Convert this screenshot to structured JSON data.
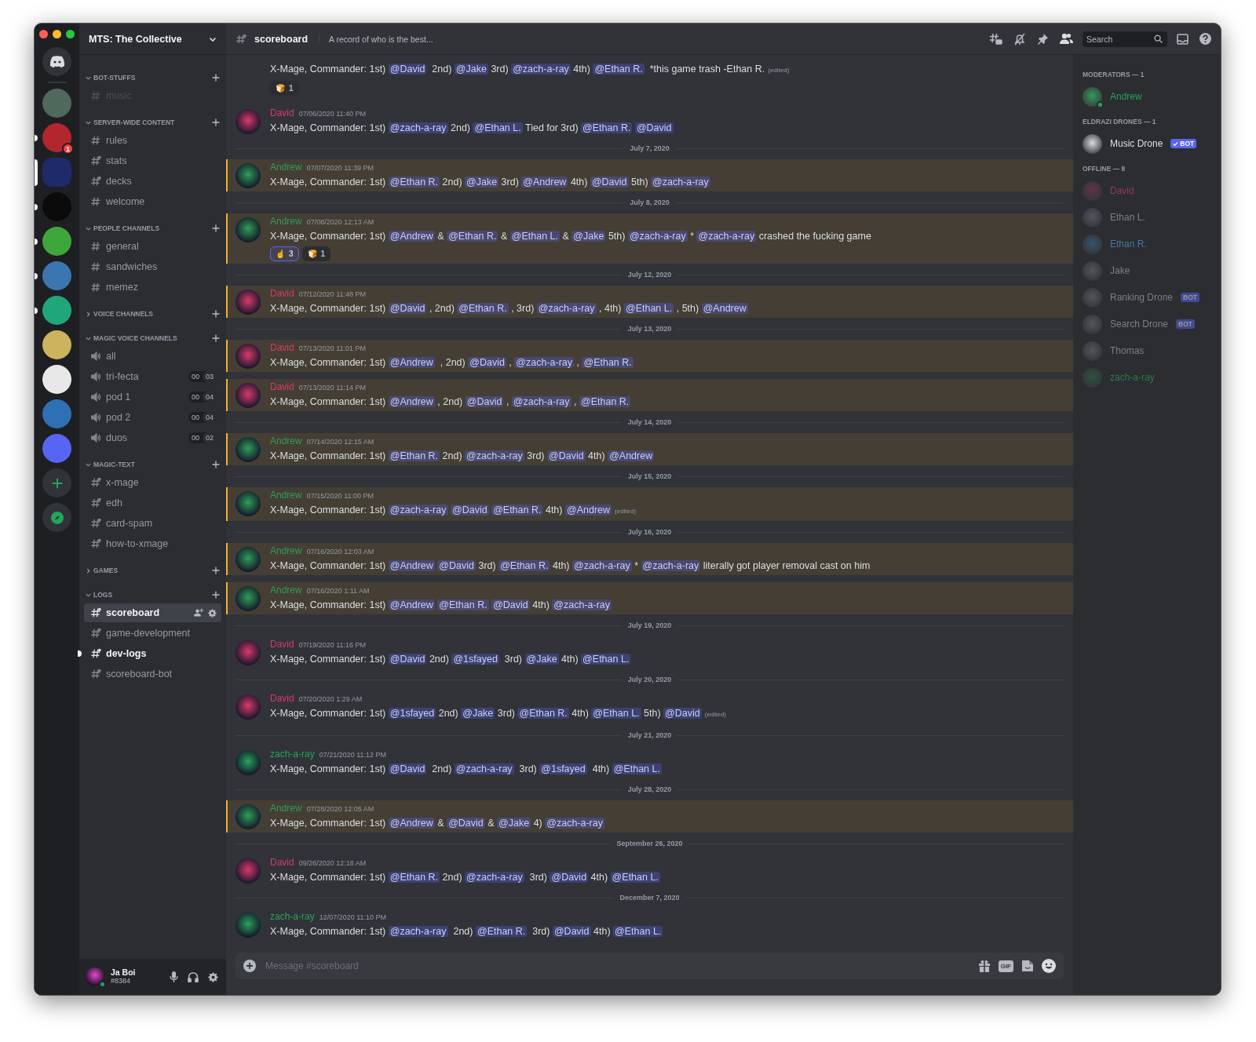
{
  "servers": [
    {
      "kind": "home",
      "selected": false,
      "unread": false
    },
    {
      "kind": "server",
      "color": "#4f6a5c",
      "selected": false,
      "unread": false
    },
    {
      "kind": "server",
      "color": "#b3262e",
      "selected": false,
      "unread": true,
      "badge": "1"
    },
    {
      "kind": "server",
      "color": "#1f2a6b",
      "selected": true,
      "unread": false
    },
    {
      "kind": "server",
      "color": "#0b0b0b",
      "selected": false,
      "unread": true
    },
    {
      "kind": "server",
      "color": "#3fa63b",
      "selected": false,
      "unread": true
    },
    {
      "kind": "server",
      "color": "#3b76b0",
      "selected": false,
      "unread": true
    },
    {
      "kind": "server",
      "color": "#1fa67a",
      "selected": false,
      "unread": true
    },
    {
      "kind": "server",
      "color": "#cdb35c",
      "selected": false,
      "unread": false
    },
    {
      "kind": "server",
      "color": "#e8e8e8",
      "selected": false,
      "unread": false
    },
    {
      "kind": "server",
      "color": "#2f6fb3",
      "selected": false,
      "unread": false
    },
    {
      "kind": "server",
      "color": "#5865f2",
      "selected": false,
      "unread": false
    },
    {
      "kind": "add",
      "selected": false,
      "unread": false
    },
    {
      "kind": "explore",
      "selected": false,
      "unread": false
    }
  ],
  "server": {
    "name": "MTS: The Collective",
    "categories": [
      {
        "name": "BOT-STUFFS",
        "expanded": true,
        "channels": [
          {
            "name": "music",
            "kind": "text",
            "selected": false,
            "unread": false,
            "muted": true
          }
        ]
      },
      {
        "name": "SERVER-WIDE CONTENT",
        "expanded": true,
        "channels": [
          {
            "name": "rules",
            "kind": "text",
            "selected": false,
            "unread": false,
            "muted": false
          },
          {
            "name": "stats",
            "kind": "locked",
            "selected": false,
            "unread": false,
            "muted": false
          },
          {
            "name": "decks",
            "kind": "locked",
            "selected": false,
            "unread": false,
            "muted": false
          },
          {
            "name": "welcome",
            "kind": "text",
            "selected": false,
            "unread": false,
            "muted": false
          }
        ]
      },
      {
        "name": "PEOPLE CHANNELS",
        "expanded": true,
        "channels": [
          {
            "name": "general",
            "kind": "text",
            "selected": false,
            "unread": false,
            "muted": false
          },
          {
            "name": "sandwiches",
            "kind": "text",
            "selected": false,
            "unread": false,
            "muted": false
          },
          {
            "name": "memez",
            "kind": "text",
            "selected": false,
            "unread": false,
            "muted": false
          }
        ]
      },
      {
        "name": "VOICE CHANNELS",
        "expanded": false
      },
      {
        "name": "MAGIC VOICE CHANNELS",
        "expanded": true,
        "channels": [
          {
            "name": "all",
            "kind": "voice",
            "selected": false,
            "unread": false,
            "muted": false
          },
          {
            "name": "tri-fecta",
            "kind": "voice",
            "selected": false,
            "unread": false,
            "muted": false,
            "users": "00",
            "limit": "03"
          },
          {
            "name": "pod 1",
            "kind": "voice",
            "selected": false,
            "unread": false,
            "muted": false,
            "users": "00",
            "limit": "04"
          },
          {
            "name": "pod 2",
            "kind": "voice",
            "selected": false,
            "unread": false,
            "muted": false,
            "users": "00",
            "limit": "04"
          },
          {
            "name": "duos",
            "kind": "voice",
            "selected": false,
            "unread": false,
            "muted": false,
            "users": "00",
            "limit": "02"
          }
        ]
      },
      {
        "name": "MAGIC-TEXT",
        "expanded": true,
        "channels": [
          {
            "name": "x-mage",
            "kind": "locked",
            "selected": false,
            "unread": false,
            "muted": false
          },
          {
            "name": "edh",
            "kind": "locked",
            "selected": false,
            "unread": false,
            "muted": false
          },
          {
            "name": "card-spam",
            "kind": "locked",
            "selected": false,
            "unread": false,
            "muted": false
          },
          {
            "name": "how-to-xmage",
            "kind": "locked",
            "selected": false,
            "unread": false,
            "muted": false
          }
        ]
      },
      {
        "name": "GAMES",
        "expanded": false
      },
      {
        "name": "LOGS",
        "expanded": true,
        "channels": [
          {
            "name": "scoreboard",
            "kind": "locked",
            "selected": true,
            "unread": false,
            "muted": false
          },
          {
            "name": "game-development",
            "kind": "locked",
            "selected": false,
            "unread": false,
            "muted": false
          },
          {
            "name": "dev-logs",
            "kind": "locked",
            "selected": false,
            "unread": true,
            "muted": false
          },
          {
            "name": "scoreboard-bot",
            "kind": "locked",
            "selected": false,
            "unread": false,
            "muted": false
          }
        ]
      }
    ]
  },
  "user": {
    "name": "Ja Boi",
    "tag": "#8384"
  },
  "channel_header": {
    "name": "scoreboard",
    "topic": "A record of who is the best...",
    "search_placeholder": "Search"
  },
  "feed": [
    {
      "kind": "message",
      "highlighted": false,
      "content": [
        "X-Mage, Commander: 1st) ",
        {
          "mention": "@David"
        },
        "  2nd) ",
        {
          "mention": "@Jake"
        },
        " 3rd) ",
        {
          "mention": "@zach-a-ray"
        },
        " 4th) ",
        {
          "mention": "@Ethan R."
        },
        "  *this game trash -Ethan R."
      ],
      "edited_note": "(edited)",
      "reactions": [
        {
          "emoji": "🍞",
          "count": "1",
          "selected": false
        }
      ]
    },
    {
      "kind": "message",
      "author": "David",
      "color": "#d83a6a",
      "timestamp": "07/06/2020 11:40 PM",
      "highlighted": false,
      "content": [
        "X-Mage, Commander: 1st) ",
        {
          "mention": "@zach-a-ray"
        },
        " 2nd) ",
        {
          "mention": "@Ethan L."
        },
        " Tied for 3rd) ",
        {
          "mention": "@Ethan R."
        },
        {
          "mention": "@David"
        }
      ]
    },
    {
      "kind": "divider",
      "label": "July 7, 2020"
    },
    {
      "kind": "message",
      "author": "Andrew",
      "color": "#2f9e58",
      "timestamp": "07/07/2020 11:39 PM",
      "highlighted": true,
      "content": [
        "X-Mage, Commander: 1st) ",
        {
          "mention": "@Ethan R."
        },
        " 2nd) ",
        {
          "mention": "@Jake"
        },
        " 3rd) ",
        {
          "mention": "@Andrew"
        },
        " 4th) ",
        {
          "mention": "@David"
        },
        " 5th) ",
        {
          "mention": "@zach-a-ray"
        }
      ]
    },
    {
      "kind": "divider",
      "label": "July 8, 2020"
    },
    {
      "kind": "message",
      "author": "Andrew",
      "color": "#2f9e58",
      "timestamp": "07/08/2020 12:13 AM",
      "highlighted": true,
      "content": [
        "X-Mage, Commander: 1st) ",
        {
          "mention": "@Andrew"
        },
        " & ",
        {
          "mention": "@Ethan R."
        },
        " & ",
        {
          "mention": "@Ethan L."
        },
        " & ",
        {
          "mention": "@Jake"
        },
        " 5th) ",
        {
          "mention": "@zach-a-ray"
        },
        " * ",
        {
          "mention": "@zach-a-ray"
        },
        " crashed the fucking game"
      ],
      "reactions": [
        {
          "emoji": "☝",
          "count": "3",
          "selected": true
        },
        {
          "emoji": "🍞",
          "count": "1",
          "selected": false
        }
      ]
    },
    {
      "kind": "divider",
      "label": "July 12, 2020"
    },
    {
      "kind": "message",
      "author": "David",
      "color": "#d83a6a",
      "timestamp": "07/12/2020 11:48 PM",
      "highlighted": true,
      "content": [
        "X-Mage, Commander: 1st) ",
        {
          "mention": "@David"
        },
        " , 2nd) ",
        {
          "mention": "@Ethan R."
        },
        " , 3rd) ",
        {
          "mention": "@zach-a-ray"
        },
        " , 4th) ",
        {
          "mention": "@Ethan L."
        },
        " , 5th) ",
        {
          "mention": "@Andrew"
        }
      ]
    },
    {
      "kind": "divider",
      "label": "July 13, 2020"
    },
    {
      "kind": "message",
      "author": "David",
      "color": "#d83a6a",
      "timestamp": "07/13/2020 11:01 PM",
      "highlighted": true,
      "content": [
        "X-Mage, Commander: 1st) ",
        {
          "mention": "@Andrew"
        },
        "  , 2nd) ",
        {
          "mention": "@David"
        },
        " , ",
        {
          "mention": "@zach-a-ray"
        },
        " , ",
        {
          "mention": "@Ethan R."
        }
      ]
    },
    {
      "kind": "message",
      "author": "David",
      "color": "#d83a6a",
      "timestamp": "07/13/2020 11:14 PM",
      "highlighted": true,
      "content": [
        "X-Mage, Commander: 1st) ",
        {
          "mention": "@Andrew"
        },
        " , 2nd) ",
        {
          "mention": "@David"
        },
        " , ",
        {
          "mention": "@zach-a-ray"
        },
        " , ",
        {
          "mention": "@Ethan R."
        }
      ]
    },
    {
      "kind": "divider",
      "label": "July 14, 2020"
    },
    {
      "kind": "message",
      "author": "Andrew",
      "color": "#2f9e58",
      "timestamp": "07/14/2020 12:15 AM",
      "highlighted": true,
      "content": [
        "X-Mage, Commander: 1st) ",
        {
          "mention": "@Ethan R."
        },
        " 2nd) ",
        {
          "mention": "@zach-a-ray"
        },
        " 3rd) ",
        {
          "mention": "@David"
        },
        " 4th) ",
        {
          "mention": "@Andrew"
        }
      ]
    },
    {
      "kind": "divider",
      "label": "July 15, 2020"
    },
    {
      "kind": "message",
      "author": "Andrew",
      "color": "#2f9e58",
      "timestamp": "07/15/2020 11:00 PM",
      "highlighted": true,
      "content": [
        "X-Mage, Commander: 1st) ",
        {
          "mention": "@zach-a-ray"
        },
        {
          "mention": "@David"
        },
        {
          "mention": "@Ethan R."
        },
        " 4th) ",
        {
          "mention": "@Andrew"
        }
      ],
      "edited_note": "(edited)"
    },
    {
      "kind": "divider",
      "label": "July 16, 2020"
    },
    {
      "kind": "message",
      "author": "Andrew",
      "color": "#2f9e58",
      "timestamp": "07/16/2020 12:03 AM",
      "highlighted": true,
      "content": [
        "X-Mage, Commander: 1st) ",
        {
          "mention": "@Andrew"
        },
        {
          "mention": "@David"
        },
        " 3rd) ",
        {
          "mention": "@Ethan R."
        },
        " 4th) ",
        {
          "mention": "@zach-a-ray"
        },
        " * ",
        {
          "mention": "@zach-a-ray"
        },
        " literally got player removal cast on him"
      ]
    },
    {
      "kind": "message",
      "author": "Andrew",
      "color": "#2f9e58",
      "timestamp": "07/16/2020 1:11 AM",
      "highlighted": true,
      "content": [
        "X-Mage, Commander: 1st) ",
        {
          "mention": "@Andrew"
        },
        {
          "mention": "@Ethan R."
        },
        {
          "mention": "@David"
        },
        " 4th) ",
        {
          "mention": "@zach-a-ray"
        }
      ]
    },
    {
      "kind": "divider",
      "label": "July 19, 2020"
    },
    {
      "kind": "message",
      "author": "David",
      "color": "#d83a6a",
      "timestamp": "07/19/2020 11:16 PM",
      "highlighted": false,
      "content": [
        "X-Mage, Commander: 1st) ",
        {
          "mention": "@David"
        },
        " 2nd) ",
        {
          "mention": "@1sfayed"
        },
        "  3rd) ",
        {
          "mention": "@Jake"
        },
        " 4th) ",
        {
          "mention": "@Ethan L."
        }
      ]
    },
    {
      "kind": "divider",
      "label": "July 20, 2020"
    },
    {
      "kind": "message",
      "author": "David",
      "color": "#d83a6a",
      "timestamp": "07/20/2020 1:29 AM",
      "highlighted": false,
      "content": [
        "X-Mage, Commander: 1st) ",
        {
          "mention": "@1sfayed"
        },
        " 2nd) ",
        {
          "mention": "@Jake"
        },
        " 3rd) ",
        {
          "mention": "@Ethan R."
        },
        " 4th) ",
        {
          "mention": "@Ethan L."
        },
        " 5th) ",
        {
          "mention": "@David"
        }
      ],
      "edited_note": "(edited)"
    },
    {
      "kind": "divider",
      "label": "July 21, 2020"
    },
    {
      "kind": "message",
      "author": "zach-a-ray",
      "color": "#27a35a",
      "timestamp": "07/21/2020 11:12 PM",
      "highlighted": false,
      "content": [
        "X-Mage, Commander: 1st) ",
        {
          "mention": "@David"
        },
        "  2nd) ",
        {
          "mention": "@zach-a-ray"
        },
        "  3rd) ",
        {
          "mention": "@1sfayed"
        },
        "  4th) ",
        {
          "mention": "@Ethan L."
        }
      ]
    },
    {
      "kind": "divider",
      "label": "July 28, 2020"
    },
    {
      "kind": "message",
      "author": "Andrew",
      "color": "#2f9e58",
      "timestamp": "07/28/2020 12:05 AM",
      "highlighted": true,
      "content": [
        "X-Mage, Commander: 1st) ",
        {
          "mention": "@Andrew"
        },
        " & ",
        {
          "mention": "@David"
        },
        " & ",
        {
          "mention": "@Jake"
        },
        " 4) ",
        {
          "mention": "@zach-a-ray"
        }
      ]
    },
    {
      "kind": "divider",
      "label": "September 26, 2020"
    },
    {
      "kind": "message",
      "author": "David",
      "color": "#d83a6a",
      "timestamp": "09/26/2020 12:18 AM",
      "highlighted": false,
      "content": [
        "X-Mage, Commander: 1st) ",
        {
          "mention": "@Ethan R."
        },
        " 2nd) ",
        {
          "mention": "@zach-a-ray"
        },
        "  3rd) ",
        {
          "mention": "@David"
        },
        " 4th) ",
        {
          "mention": "@Ethan L."
        }
      ]
    },
    {
      "kind": "divider",
      "label": "December 7, 2020"
    },
    {
      "kind": "message",
      "author": "zach-a-ray",
      "color": "#27a35a",
      "timestamp": "12/07/2020 11:10 PM",
      "highlighted": false,
      "content": [
        "X-Mage, Commander: 1st) ",
        {
          "mention": "@zach-a-ray"
        },
        "  2nd) ",
        {
          "mention": "@Ethan R."
        },
        "  3rd) ",
        {
          "mention": "@David"
        },
        " 4th) ",
        {
          "mention": "@Ethan L."
        }
      ]
    }
  ],
  "composer": {
    "placeholder": "Message #scoreboard",
    "gif_label": "GIF"
  },
  "members": {
    "groups": [
      {
        "title": "MODERATORS — 1",
        "members": [
          {
            "name": "Andrew",
            "color": "#2f9e58",
            "online": true,
            "offline": false
          }
        ]
      },
      {
        "title": "ELDRAZI DRONES — 1",
        "members": [
          {
            "name": "Music Drone",
            "color": "#dbdee1",
            "online": false,
            "offline": false,
            "bot_tag": "BOT",
            "verified": true
          }
        ]
      },
      {
        "title": "OFFLINE — 8",
        "members": [
          {
            "name": "David",
            "color": "#9a3a5c",
            "online": false,
            "offline": true
          },
          {
            "name": "Ethan L.",
            "color": "#7c7f86",
            "online": false,
            "offline": true
          },
          {
            "name": "Ethan R.",
            "color": "#4577a3",
            "online": false,
            "offline": true
          },
          {
            "name": "Jake",
            "color": "#7c7f86",
            "online": false,
            "offline": true
          },
          {
            "name": "Ranking Drone",
            "color": "#7c7f86",
            "online": false,
            "offline": true,
            "bot_tag": "BOT",
            "verified": false
          },
          {
            "name": "Search Drone",
            "color": "#7c7f86",
            "online": false,
            "offline": true,
            "bot_tag": "BOT",
            "verified": false
          },
          {
            "name": "Thomas",
            "color": "#7c7f86",
            "online": false,
            "offline": true
          },
          {
            "name": "zach-a-ray",
            "color": "#2f7a4c",
            "online": false,
            "offline": true
          }
        ]
      }
    ]
  }
}
